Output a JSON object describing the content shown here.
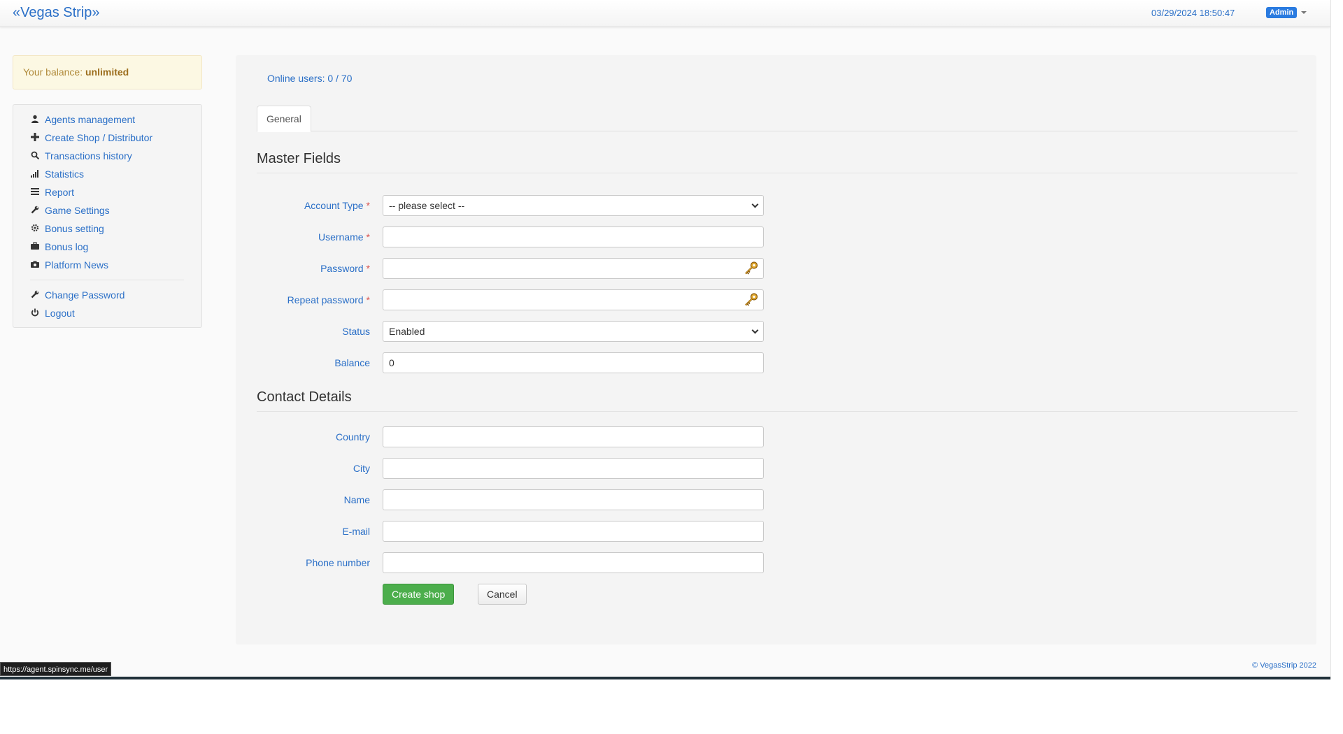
{
  "header": {
    "brand": "«Vegas Strip»",
    "datetime": "03/29/2024 18:50:47",
    "user_badge": "Admin"
  },
  "sidebar": {
    "balance_label": "Your balance:",
    "balance_value": "unlimited",
    "items": [
      {
        "label": "Agents management",
        "icon": "user-icon"
      },
      {
        "label": "Create Shop / Distributor",
        "icon": "plus-icon"
      },
      {
        "label": "Transactions history",
        "icon": "search-icon"
      },
      {
        "label": "Statistics",
        "icon": "signal-icon"
      },
      {
        "label": "Report",
        "icon": "list-icon"
      },
      {
        "label": "Game Settings",
        "icon": "wrench-icon"
      },
      {
        "label": "Bonus setting",
        "icon": "gear-icon"
      },
      {
        "label": "Bonus log",
        "icon": "briefcase-icon"
      },
      {
        "label": "Platform News",
        "icon": "camera-icon"
      }
    ],
    "account_items": [
      {
        "label": "Change Password",
        "icon": "wrench-icon"
      },
      {
        "label": "Logout",
        "icon": "power-icon"
      }
    ]
  },
  "main": {
    "online_users": "Online users: 0 / 70",
    "tabs": [
      {
        "label": "General"
      }
    ],
    "master_title": "Master Fields",
    "contact_title": "Contact Details",
    "fields": {
      "account_type": {
        "label": "Account Type",
        "value": "-- please select --"
      },
      "username": {
        "label": "Username",
        "value": ""
      },
      "password": {
        "label": "Password",
        "value": ""
      },
      "repeat_password": {
        "label": "Repeat password",
        "value": ""
      },
      "status": {
        "label": "Status",
        "value": "Enabled"
      },
      "balance": {
        "label": "Balance",
        "value": "0"
      },
      "country": {
        "label": "Country",
        "value": ""
      },
      "city": {
        "label": "City",
        "value": ""
      },
      "name": {
        "label": "Name",
        "value": ""
      },
      "email": {
        "label": "E-mail",
        "value": ""
      },
      "phone": {
        "label": "Phone number",
        "value": ""
      }
    },
    "required_mark": "*",
    "create_button": "Create shop",
    "cancel_button": "Cancel"
  },
  "footer": {
    "copyright": "© VegasStrip 2022",
    "status_url": "https://agent.spinsync.me/user"
  }
}
